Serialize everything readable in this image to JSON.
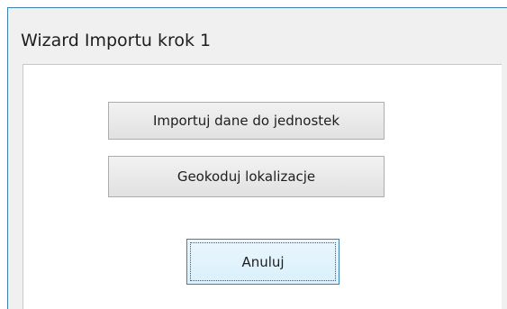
{
  "window": {
    "title": "Wizard Importu krok 1"
  },
  "buttons": {
    "import_label": "Importuj dane do jednostek",
    "geocode_label": "Geokoduj lokalizacje",
    "cancel_label": "Anuluj"
  },
  "colors": {
    "window_border": "#3c7fb1",
    "window_bg": "#f0f0f0",
    "panel_bg": "#ffffff",
    "button_border": "#adadad",
    "focused_button_border": "#3c7fb1"
  }
}
